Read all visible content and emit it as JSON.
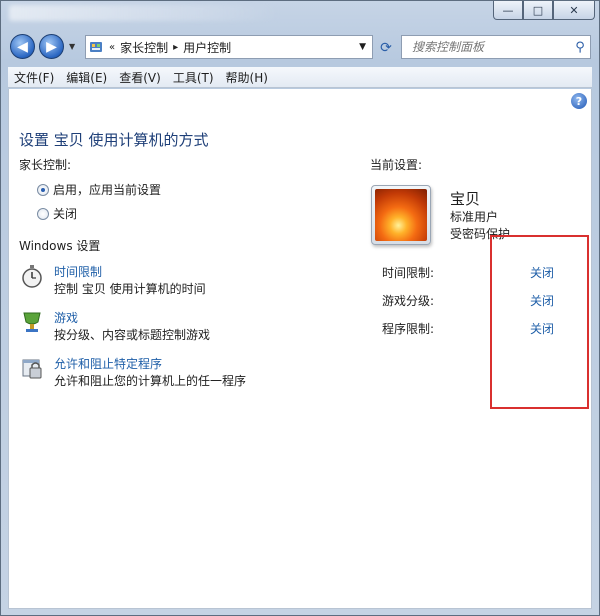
{
  "titlebar": {
    "buttons": {
      "minimize": "—",
      "maximize": "□",
      "close": "✕"
    }
  },
  "nav": {
    "back_icon": "back-arrow-icon",
    "forward_icon": "forward-arrow-icon",
    "breadcrumb_prefix": "«",
    "breadcrumbs": [
      "家长控制",
      "用户控制"
    ],
    "search_placeholder": "搜索控制面板"
  },
  "menu": {
    "items": [
      "文件(F)",
      "编辑(E)",
      "查看(V)",
      "工具(T)",
      "帮助(H)"
    ]
  },
  "content": {
    "title": "设置 宝贝 使用计算机的方式",
    "parental_label": "家长控制:",
    "radio_on": "启用，应用当前设置",
    "radio_off": "关闭",
    "windows_settings_label": "Windows 设置",
    "tasks": [
      {
        "link": "时间限制",
        "desc": "控制 宝贝 使用计算机的时间",
        "icon": "stopwatch-icon"
      },
      {
        "link": "游戏",
        "desc": "按分级、内容或标题控制游戏",
        "icon": "game-controller-icon"
      },
      {
        "link": "允许和阻止特定程序",
        "desc": "允许和阻止您的计算机上的任一程序",
        "icon": "program-blocker-icon"
      }
    ],
    "current_settings_label": "当前设置:",
    "user": {
      "name": "宝贝",
      "type": "标准用户",
      "password": "受密码保护"
    },
    "settings": [
      {
        "label": "时间限制:",
        "value": "关闭"
      },
      {
        "label": "游戏分级:",
        "value": "关闭"
      },
      {
        "label": "程序限制:",
        "value": "关闭"
      }
    ]
  },
  "colors": {
    "link": "#1f5fa8",
    "title": "#1e3f78",
    "annotation_box": "#d9302f"
  }
}
